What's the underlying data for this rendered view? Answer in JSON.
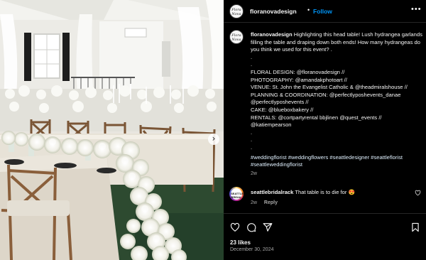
{
  "post": {
    "username": "floranovadesign",
    "follow_label": "Follow",
    "header_separator": "•",
    "more_label": "•••",
    "avatar_text": "Flora Nova",
    "caption_lines": [
      "Highlighting this head table! Lush hydrangea garlands filling the table and draping down both ends! How many hydrangeas do you think we used for this event? .",
      ".",
      ".",
      "FLORAL DESIGN: @floranovadesign //",
      "PHOTOGRAPHY: @amandakphotoart //",
      "VENUE: St. John the Evangelist Catholic & @theadmiralshouse //",
      "PLANNING & COORDINATION: @perfectlyposhevents_danae @perfectlyposhevents //",
      "CAKE: @blueboxbakery //",
      "RENTALS: @cortpartyrental bbjlinen @quest_events // @katiempearson",
      ".",
      ".",
      "."
    ],
    "hashtags": "#weddingflorist #weddingflowers #seattledesigner #seattleflorist #seattleweddingflorist",
    "caption_age": "2w"
  },
  "comment": {
    "username": "seattlebridalrack",
    "text": "That table is to die for 😍",
    "age": "2w",
    "reply_label": "Reply",
    "avatar_text": "SEATTLE BRIDAL"
  },
  "footer": {
    "likes": "23 likes",
    "date": "December 30, 2024"
  },
  "photo": {
    "next_arrow": "›"
  },
  "icons": {
    "heart": "heart-icon",
    "comment": "comment-icon",
    "share": "share-icon",
    "save": "bookmark-icon",
    "more": "more-options-icon"
  },
  "colors": {
    "background": "#000000",
    "text": "#f5f5f5",
    "muted": "#a8a8a8",
    "follow": "#0095f6",
    "divider": "#262626"
  }
}
